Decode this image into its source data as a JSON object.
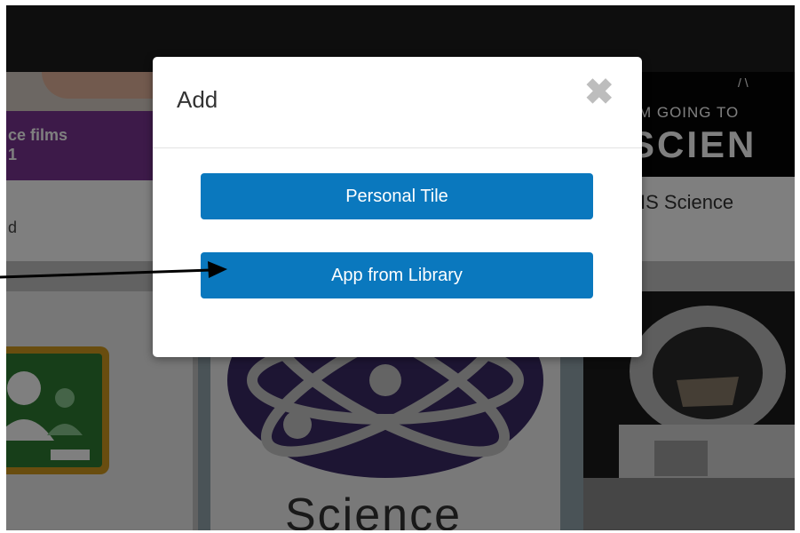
{
  "tiles": {
    "tile1": {
      "band_text": "ce films\n1",
      "sub_text": "d"
    },
    "tile3": {
      "poster_line1": "I'M GOING TO",
      "poster_line2": "SCIEN",
      "label": "IS Science"
    },
    "tile5": {
      "label": "Science"
    }
  },
  "modal": {
    "title": "Add",
    "close_glyph": "✖",
    "buttons": [
      {
        "label": "Personal Tile"
      },
      {
        "label": "App from Library"
      }
    ]
  },
  "colors": {
    "topbar": "#1d1d1d",
    "purple_band": "#7b3593",
    "primary_button": "#0a78be",
    "close_icon": "#bdbdbd",
    "classroom_green": "#2e7d32",
    "classroom_frame": "#d39b1f",
    "atom_purple": "#3a2a66"
  },
  "icons": [
    "close-icon",
    "google-classroom-icon",
    "atom-icon",
    "astronaut-photo",
    "annotation-arrow"
  ]
}
